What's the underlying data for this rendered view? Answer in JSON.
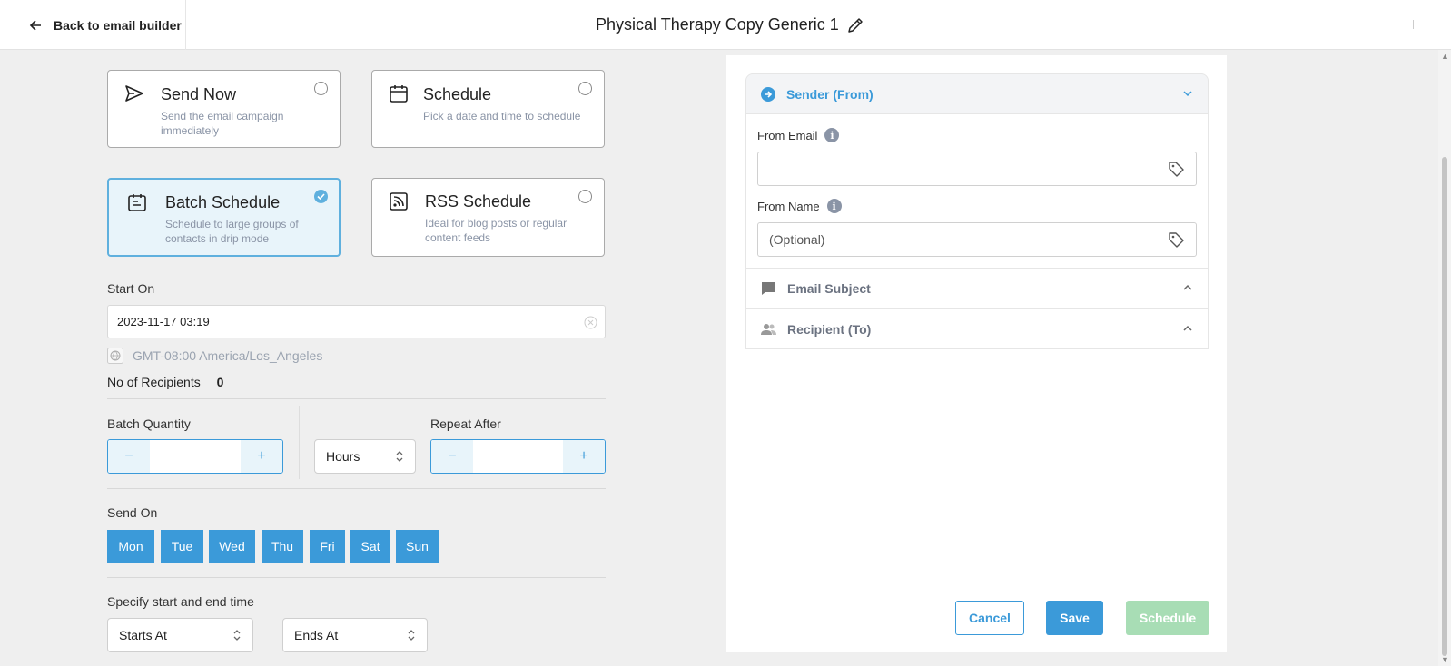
{
  "topbar": {
    "back_label": "Back to email builder",
    "title": "Physical Therapy Copy Generic 1"
  },
  "cards": [
    {
      "title": "Send Now",
      "desc": "Send the email campaign immediately",
      "icon": "send-icon",
      "selected": false
    },
    {
      "title": "Schedule",
      "desc": "Pick a date and time to schedule",
      "icon": "calendar-icon",
      "selected": false
    },
    {
      "title": "Batch Schedule",
      "desc": "Schedule to large groups of contacts in drip mode",
      "icon": "batch-calendar-icon",
      "selected": true
    },
    {
      "title": "RSS Schedule",
      "desc": "Ideal for blog posts or regular content feeds",
      "icon": "rss-icon",
      "selected": false
    }
  ],
  "start_on": {
    "label": "Start On",
    "value": "2023-11-17 03:19",
    "timezone": "GMT-08:00 America/Los_Angeles"
  },
  "recipients": {
    "label": "No of Recipients",
    "count": "0"
  },
  "batch": {
    "quantity_label": "Batch Quantity",
    "minus": "−",
    "plus": "+",
    "unit": "Hours",
    "repeat_label": "Repeat After"
  },
  "send_on": {
    "label": "Send On",
    "days": [
      "Mon",
      "Tue",
      "Wed",
      "Thu",
      "Fri",
      "Sat",
      "Sun"
    ]
  },
  "time_range": {
    "label": "Specify start and end time",
    "starts": "Starts At",
    "ends": "Ends At"
  },
  "panel": {
    "sender_title": "Sender (From)",
    "from_email_label": "From Email",
    "from_email_value": "",
    "from_name_label": "From Name",
    "from_name_placeholder": "(Optional)",
    "subject_title": "Email Subject",
    "recipient_title": "Recipient (To)"
  },
  "actions": {
    "cancel": "Cancel",
    "save": "Save",
    "schedule": "Schedule"
  },
  "colors": {
    "accent": "#3b9ad9",
    "schedule_disabled": "#a8ddb5",
    "selected_bg": "#e8f4fa"
  }
}
